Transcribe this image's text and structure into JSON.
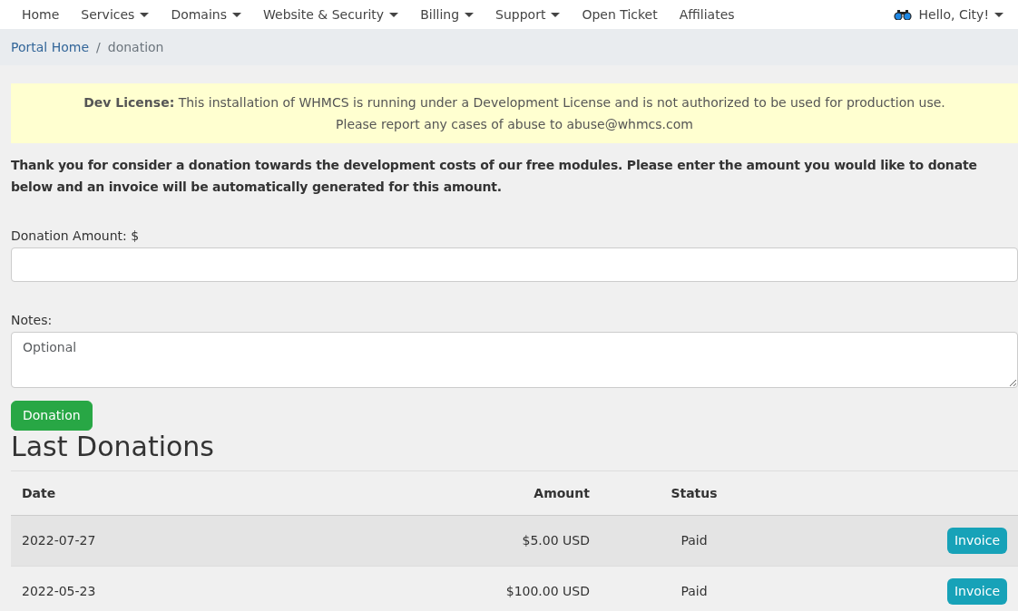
{
  "nav": {
    "items": [
      {
        "label": "Home",
        "dropdown": false
      },
      {
        "label": "Services",
        "dropdown": true
      },
      {
        "label": "Domains",
        "dropdown": true
      },
      {
        "label": "Website & Security",
        "dropdown": true
      },
      {
        "label": "Billing",
        "dropdown": true
      },
      {
        "label": "Support",
        "dropdown": true
      },
      {
        "label": "Open Ticket",
        "dropdown": false
      },
      {
        "label": "Affiliates",
        "dropdown": false
      }
    ],
    "user": {
      "label": "Hello, City!",
      "dropdown": true
    }
  },
  "breadcrumb_separator": "/",
  "breadcrumb": [
    {
      "label": "Portal Home",
      "link": true
    },
    {
      "label": "donation",
      "link": false
    }
  ],
  "alert": {
    "text": "**Dev License:** This installation of WHMCS is running under a Development License and is not authorized to be used for production use.",
    "text2": "Please report any cases of abuse to abuse@whmcs.com"
  },
  "intro": "Thank you for consider a donation towards the development costs of our free modules. Please enter the amount you would like to donate below and an invoice will be automatically generated for this amount.",
  "form": {
    "amount_label": "Donation Amount: $",
    "notes_label": "Notes:",
    "notes_placeholder": "Optional",
    "submit": "Donation"
  },
  "donations": {
    "title": "Last Donations",
    "columns": [
      "Date",
      "Amount",
      "Status"
    ],
    "rows": [
      {
        "date": "2022-07-27",
        "amount": "$5.00 USD",
        "status": "Paid",
        "action": "Invoice"
      },
      {
        "date": "2022-05-23",
        "amount": "$100.00 USD",
        "status": "Paid",
        "action": "Invoice"
      }
    ]
  }
}
